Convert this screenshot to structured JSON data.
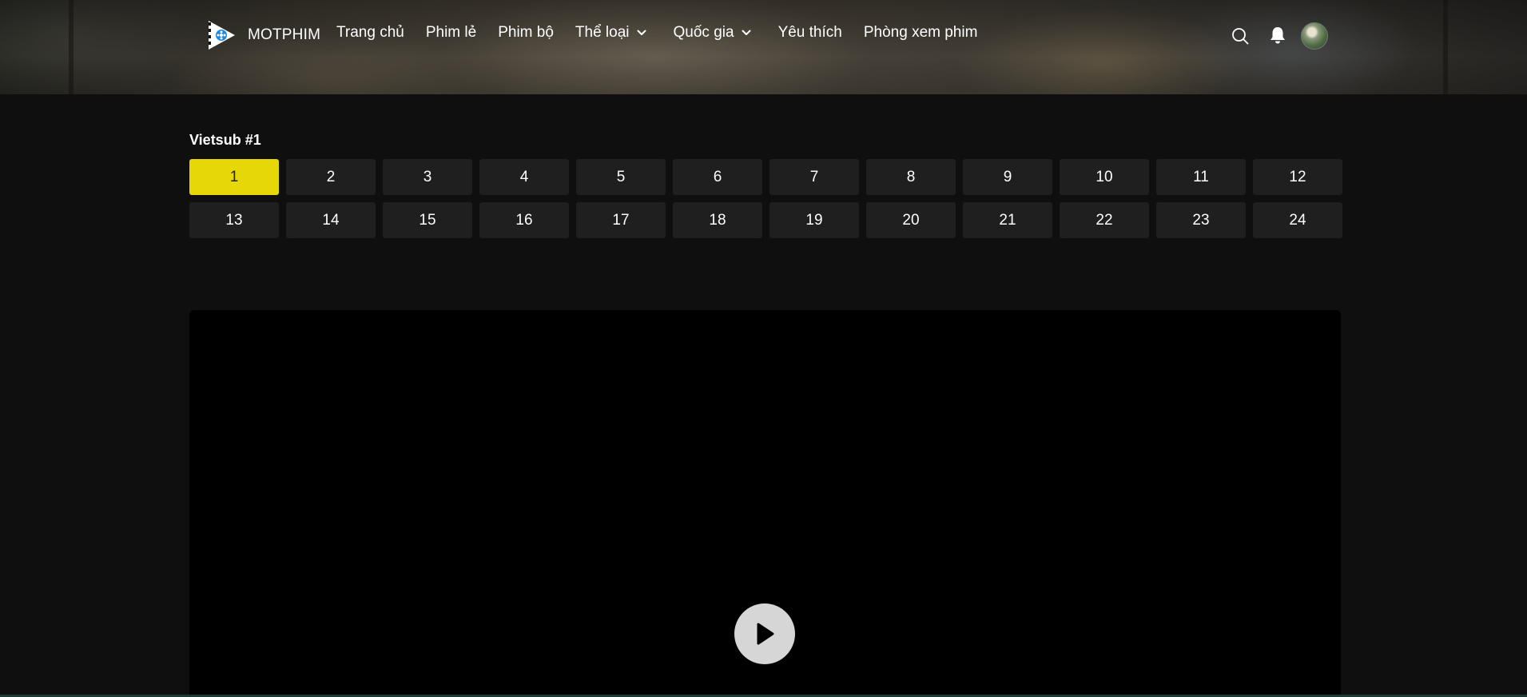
{
  "brand": {
    "name": "MOTPHIM"
  },
  "nav": {
    "items": [
      {
        "label": "Trang chủ",
        "dropdown": false
      },
      {
        "label": "Phim lẻ",
        "dropdown": false
      },
      {
        "label": "Phim bộ",
        "dropdown": false
      },
      {
        "label": "Thể loại",
        "dropdown": true
      },
      {
        "label": "Quốc gia",
        "dropdown": true
      },
      {
        "label": "Yêu thích",
        "dropdown": false
      },
      {
        "label": "Phòng xem phim",
        "dropdown": false
      }
    ],
    "icons": [
      "search-icon",
      "bell-icon",
      "avatar"
    ]
  },
  "server": {
    "label": "Vietsub #1"
  },
  "episodes": {
    "active": "1",
    "list": [
      "1",
      "2",
      "3",
      "4",
      "5",
      "6",
      "7",
      "8",
      "9",
      "10",
      "11",
      "12",
      "13",
      "14",
      "15",
      "16",
      "17",
      "18",
      "19",
      "20",
      "21",
      "22",
      "23",
      "24"
    ]
  },
  "player": {
    "icon": "play-icon"
  },
  "colors": {
    "accent": "#e6d708",
    "background": "#0f0f0f",
    "episode_bg": "#1f1f1f"
  }
}
